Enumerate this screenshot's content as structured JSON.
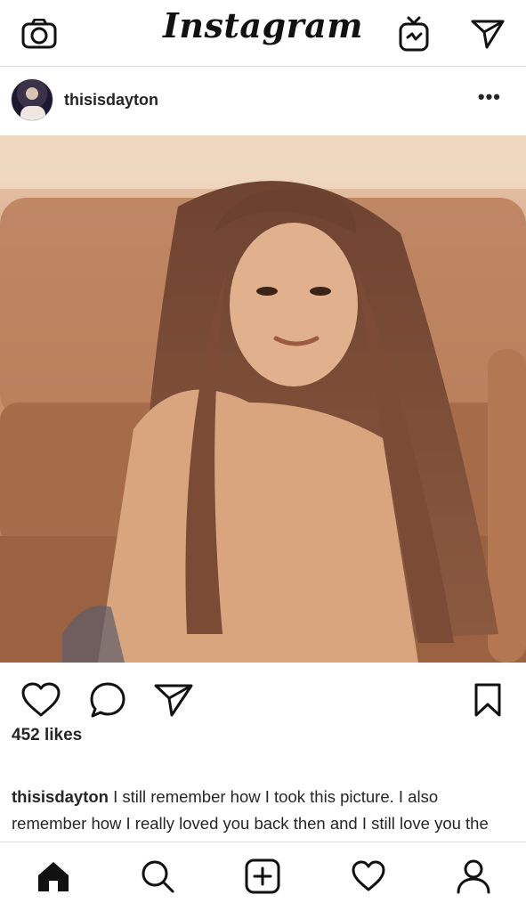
{
  "app": {
    "brand": "Instagram"
  },
  "topbar": {
    "camera_icon": "camera-icon",
    "igtv_icon": "igtv-icon",
    "direct_icon": "direct-message-icon"
  },
  "post": {
    "username": "thisisdayton",
    "more_label": "•••",
    "photo_description_icon": "photo",
    "likes": "452 likes",
    "caption": {
      "username": "thisisdayton",
      "text": "I still remember how I took this picture. I also remember how I really loved you back then and I still love you the way I loved you before."
    }
  },
  "bottom_nav": {
    "items": [
      "home-icon",
      "search-icon",
      "add-post-icon",
      "activity-heart-icon",
      "profile-icon"
    ]
  },
  "colors": {
    "text": "#262626",
    "divider": "#dbdbdb",
    "photo_tone": "#cf9d79"
  }
}
